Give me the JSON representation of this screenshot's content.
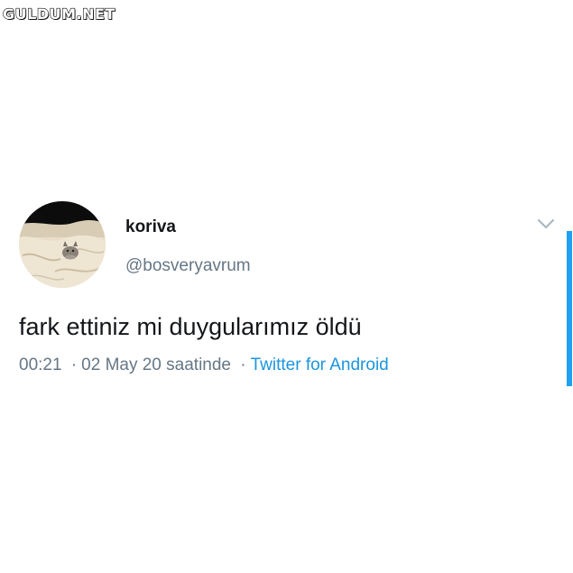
{
  "watermark": {
    "text": "GULDUM.NET"
  },
  "tweet": {
    "author": {
      "display_name": "koriva",
      "handle": "@bosveryavrum",
      "avatar": "kitten-on-bed-photo"
    },
    "text": "fark ettiniz mi duygularımız öldü",
    "time": "00:21",
    "separator": "·",
    "date_label": "02 May 20 saatinde",
    "source": "Twitter for Android",
    "menu_icon": "chevron-down-icon"
  },
  "colors": {
    "text": "#14171a",
    "secondary": "#657786",
    "link": "#1b95e0",
    "accent": "#1da1f2",
    "background": "#ffffff"
  }
}
